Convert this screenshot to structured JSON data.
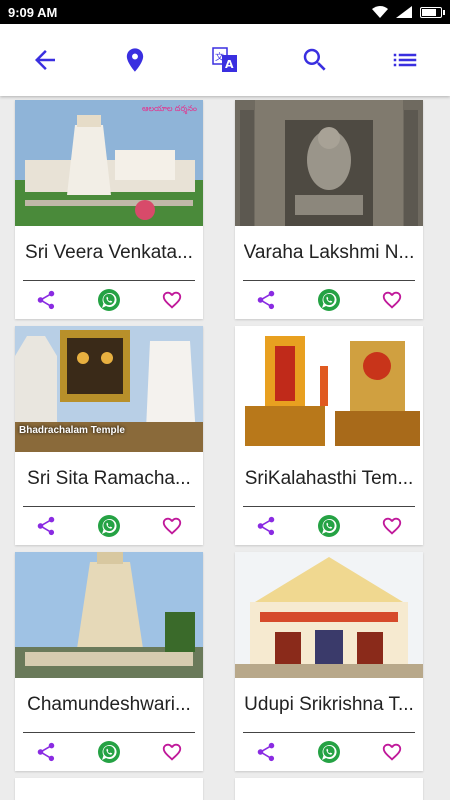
{
  "status": {
    "time": "9:09 AM",
    "battery_level": 0.8
  },
  "toolbar": {
    "icons": [
      "back-arrow-icon",
      "location-pin-icon",
      "translate-icon",
      "search-icon",
      "list-icon"
    ],
    "accent": "#3a2fe0"
  },
  "cards": [
    {
      "title": "Sri Veera Venkata Satyanarayana Temple",
      "display": "Sri Veera Venkata...",
      "img_tag": "ఆలయాల దర్శనం"
    },
    {
      "title": "Varaha Lakshmi Narasimha Temple",
      "display": "Varaha Lakshmi N..."
    },
    {
      "title": "Sri Sita Ramachandra Swamy Temple",
      "display": "Sri Sita Ramacha...",
      "img_caption": "Bhadrachalam Temple"
    },
    {
      "title": "SriKalahasthi Temple",
      "display": "SriKalahasthi Tem..."
    },
    {
      "title": "Chamundeshwari Temple",
      "display": "Chamundeshwari..."
    },
    {
      "title": "Udupi Srikrishna Temple",
      "display": "Udupi Srikrishna T..."
    }
  ],
  "colors": {
    "share": "#8a2be2",
    "whatsapp": "#25a244",
    "heart": "#c0189a"
  }
}
